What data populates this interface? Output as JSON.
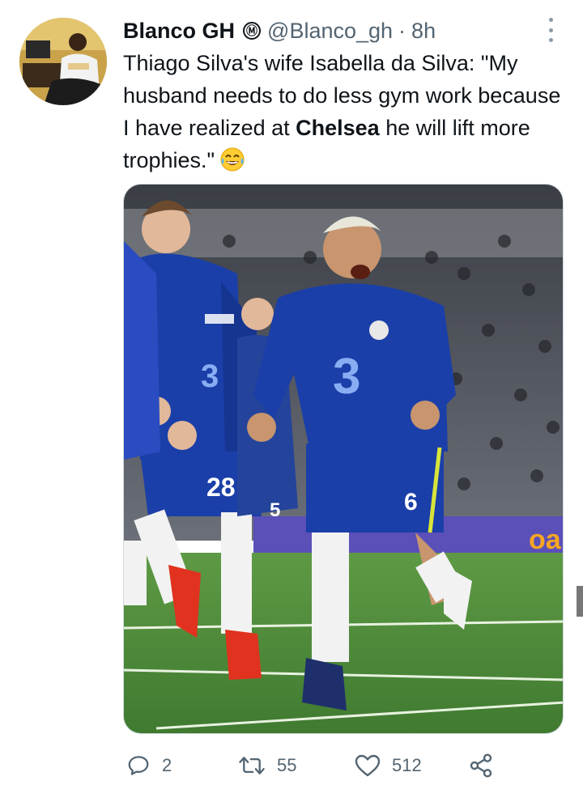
{
  "author": {
    "display_name": "Blanco GH",
    "badge_glyph": "Ⓜ",
    "handle": "@Blanco_gh",
    "separator": "·",
    "time_ago": "8h",
    "avatar_icon": "user-avatar"
  },
  "tweet": {
    "text_before": "Thiago Silva's wife Isabella da Silva: \"My husband needs to do less gym work because I have realized at ",
    "text_bold": "Chelsea",
    "text_after": " he will lift more trophies.\"",
    "emoji": "face-with-tears-of-joy-emoji"
  },
  "media": {
    "shirt_numbers": [
      "28",
      "5",
      "6"
    ],
    "shirt_sponsor_glyph": "3"
  },
  "actions": {
    "reply_count": "2",
    "retweet_count": "55",
    "like_count": "512"
  },
  "colors": {
    "kit_blue": "#1b3fa8",
    "pitch_green": "#4f8a3b",
    "text_primary": "#0f1419",
    "text_secondary": "#536471"
  }
}
